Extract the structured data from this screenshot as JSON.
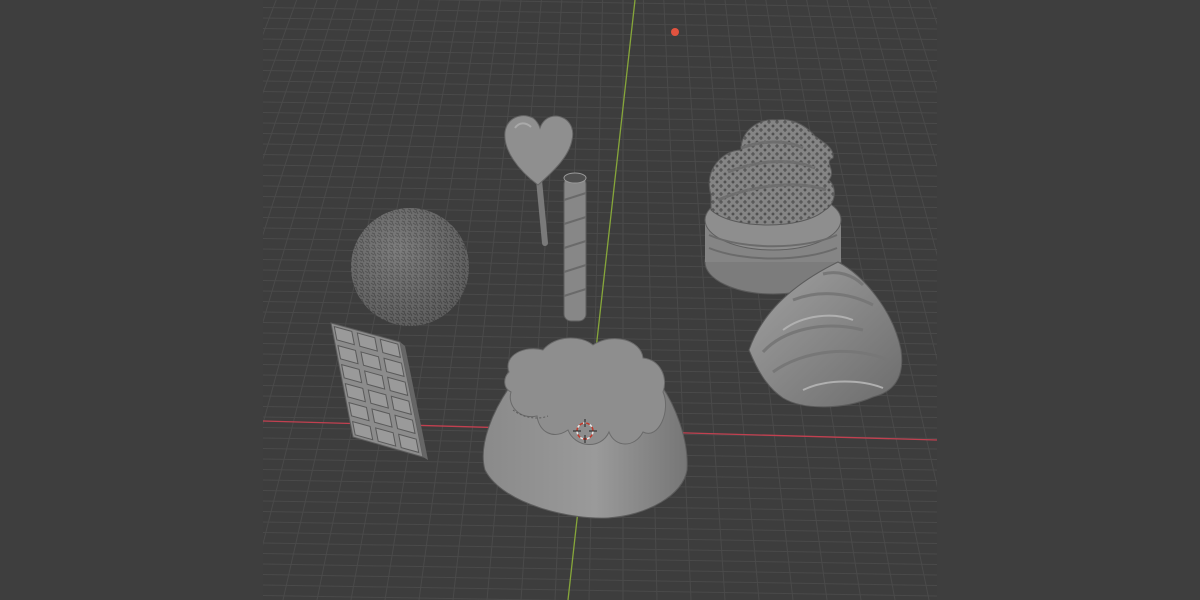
{
  "app": {
    "name": "3D Viewport",
    "shading_mode": "solid"
  },
  "colors": {
    "background": "#3d3d3d",
    "side_panels": "#3e3e3e",
    "grid_line": "#4a4a4a",
    "x_axis": "#c24050",
    "y_axis": "#86a63a",
    "object_fill": "#8a8a8a",
    "object_shadow": "#6e6e6e",
    "object_highlight": "#a8a8a8",
    "gizmo_x": "#e2533f"
  },
  "scene": {
    "objects": [
      "heart-lollipop",
      "wafer-straw",
      "sprinkled-ball",
      "chocolate-bar",
      "pudding-cake",
      "cream-cupcake",
      "cream-swirl"
    ],
    "cursor": "3d-cursor"
  }
}
